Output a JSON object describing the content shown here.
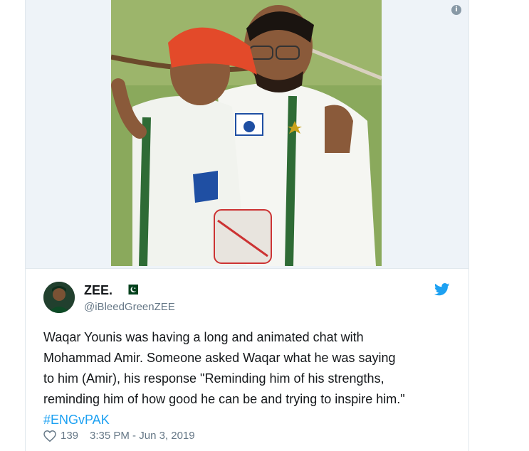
{
  "colors": {
    "accent": "#1da1f2",
    "text": "#14171a",
    "secondary": "#657786",
    "flag_green": "#01411c"
  },
  "media": {
    "photo_description_icon": "info-icon",
    "info_label": "i"
  },
  "author": {
    "name": "ZEE.",
    "flag_icon": "pakistan-flag-icon",
    "handle": "@iBleedGreenZEE",
    "avatar_icon": "avatar"
  },
  "brand": {
    "icon": "twitter-bird-icon"
  },
  "tweet": {
    "line1": "Waqar Younis was having a long and animated chat with",
    "line2": "Mohammad Amir. Someone asked Waqar what he was saying",
    "line3": "to him (Amir), his response \"Reminding him of his strengths,",
    "line4": "reminding him of how good he can be and trying to inspire him.\"",
    "hashtag": "#ENGvPAK"
  },
  "footer": {
    "like_icon": "heart-icon",
    "likes": "139",
    "timestamp": "3:35 PM - Jun 3, 2019"
  }
}
